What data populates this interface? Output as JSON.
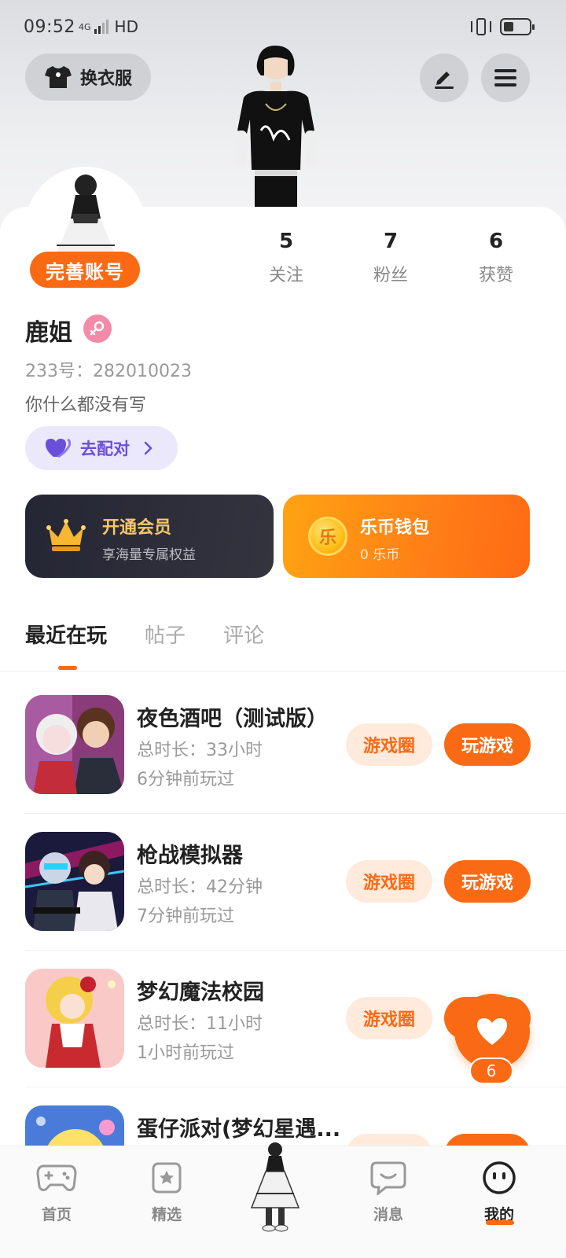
{
  "status_bar": {
    "time": "09:52",
    "network": "4G",
    "hd": "HD",
    "battery_level": 0.4
  },
  "header": {
    "wardrobe_label": "换衣服",
    "wardrobe_icon": "tshirt-icon",
    "edit_icon": "pencil-icon",
    "menu_icon": "hamburger-menu-icon"
  },
  "profile": {
    "complete_label": "完善账号",
    "name": "鹿姐",
    "gender_icon": "female-icon",
    "uid": "233号：282010023",
    "bio": "你什么都没有写",
    "match_label": "去配对",
    "stats": [
      {
        "num": "5",
        "label": "关注"
      },
      {
        "num": "7",
        "label": "粉丝"
      },
      {
        "num": "6",
        "label": "获赞"
      }
    ]
  },
  "vip": {
    "title": "开通会员",
    "subtitle": "享海量专属权益",
    "icon": "crown-icon"
  },
  "wallet": {
    "title": "乐币钱包",
    "subtitle": "0 乐币",
    "coin_char": "乐"
  },
  "tabs": [
    {
      "label": "最近在玩",
      "active": true
    },
    {
      "label": "帖子",
      "active": false
    },
    {
      "label": "评论",
      "active": false
    }
  ],
  "games": [
    {
      "title": "夜色酒吧（测试版）",
      "duration": "总时长：33小时",
      "last_played": "6分钟前玩过",
      "circle_label": "游戏圈",
      "play_label": "玩游戏"
    },
    {
      "title": "枪战模拟器",
      "duration": "总时长：42分钟",
      "last_played": "7分钟前玩过",
      "circle_label": "游戏圈",
      "play_label": "玩游戏"
    },
    {
      "title": "梦幻魔法校园",
      "duration": "总时长：11小时",
      "last_played": "1小时前玩过",
      "circle_label": "游戏圈",
      "play_label": "玩游戏"
    },
    {
      "title": "蛋仔派对(梦幻星遇...",
      "duration": "",
      "last_played": "",
      "circle_label": "游戏圈",
      "play_label": "玩游戏"
    }
  ],
  "float_like": {
    "count": "6",
    "icon": "heart-icon"
  },
  "bottom_nav": [
    {
      "label": "首页",
      "icon": "gamepad-icon"
    },
    {
      "label": "精选",
      "icon": "star-card-icon"
    },
    {
      "label": "",
      "icon": "avatar-center-icon"
    },
    {
      "label": "消息",
      "icon": "chat-bubble-icon"
    },
    {
      "label": "我的",
      "icon": "smiley-face-icon"
    }
  ],
  "colors": {
    "accent": "#fa6a14",
    "match": "#6a4fd8",
    "vip_gold": "#f6c66a"
  }
}
